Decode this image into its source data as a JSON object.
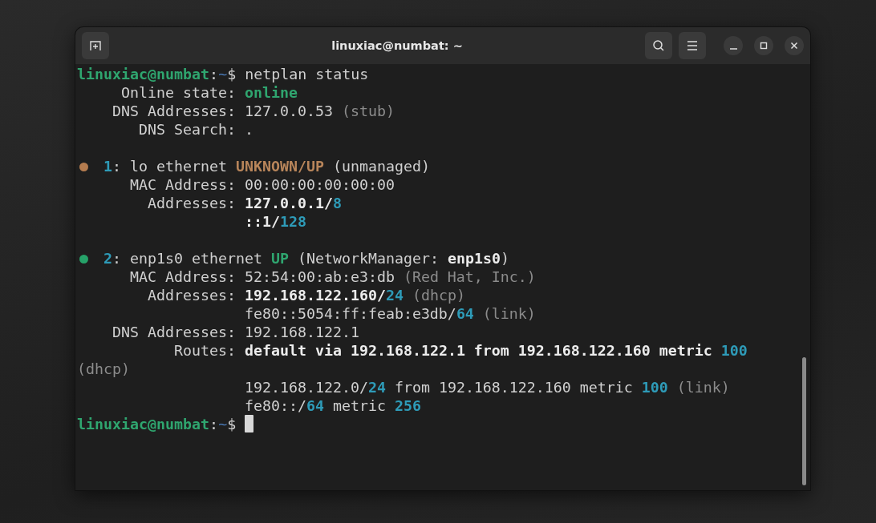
{
  "window": {
    "title": "linuxiac@numbat: ~"
  },
  "terminal": {
    "lines": [
      {
        "kind": "prompt",
        "segments": [
          {
            "kind": "user",
            "text": "linuxiac@numbat"
          },
          {
            "kind": "plain",
            "text": ":"
          },
          {
            "kind": "path",
            "text": "~"
          },
          {
            "kind": "plain",
            "text": "$ netplan status"
          }
        ]
      },
      {
        "kind": "text",
        "segments": [
          {
            "kind": "plain",
            "text": "     Online state: "
          },
          {
            "kind": "green",
            "text": "online"
          }
        ]
      },
      {
        "kind": "text",
        "segments": [
          {
            "kind": "plain",
            "text": "    DNS Addresses: 127.0.0.53"
          },
          {
            "kind": "dim",
            "text": " (stub)"
          }
        ]
      },
      {
        "kind": "text",
        "segments": [
          {
            "kind": "plain",
            "text": "       DNS Search: ."
          }
        ]
      },
      {
        "kind": "blank"
      },
      {
        "kind": "text",
        "dot": {
          "color": "#b57c4f"
        },
        "segments": [
          {
            "kind": "cyan",
            "text": "1"
          },
          {
            "kind": "plain",
            "text": ": lo ethernet "
          },
          {
            "kind": "amber",
            "text": "UNKNOWN/UP"
          },
          {
            "kind": "plain",
            "text": " (unmanaged)"
          }
        ]
      },
      {
        "kind": "text",
        "segments": [
          {
            "kind": "plain",
            "text": "      MAC Address: 00:00:00:00:00:00"
          }
        ]
      },
      {
        "kind": "text",
        "segments": [
          {
            "kind": "plain",
            "text": "        Addresses: "
          },
          {
            "kind": "bold",
            "text": "127.0.0.1/"
          },
          {
            "kind": "cyan",
            "text": "8"
          }
        ]
      },
      {
        "kind": "text",
        "segments": [
          {
            "kind": "bold",
            "text": "                   ::1/"
          },
          {
            "kind": "cyan",
            "text": "128"
          }
        ]
      },
      {
        "kind": "blank"
      },
      {
        "kind": "text",
        "dot": {
          "color": "#26a269"
        },
        "segments": [
          {
            "kind": "cyan",
            "text": "2"
          },
          {
            "kind": "plain",
            "text": ": enp1s0 ethernet "
          },
          {
            "kind": "green",
            "text": "UP"
          },
          {
            "kind": "plain",
            "text": " (NetworkManager: "
          },
          {
            "kind": "bold",
            "text": "enp1s0"
          },
          {
            "kind": "plain",
            "text": ")"
          }
        ]
      },
      {
        "kind": "text",
        "segments": [
          {
            "kind": "plain",
            "text": "      MAC Address: 52:54:00:ab:e3:db"
          },
          {
            "kind": "dim",
            "text": " (Red Hat, Inc.)"
          }
        ]
      },
      {
        "kind": "text",
        "segments": [
          {
            "kind": "plain",
            "text": "        Addresses: "
          },
          {
            "kind": "bold",
            "text": "192.168.122.160/"
          },
          {
            "kind": "cyan",
            "text": "24"
          },
          {
            "kind": "dim",
            "text": " (dhcp)"
          }
        ]
      },
      {
        "kind": "text",
        "segments": [
          {
            "kind": "plain",
            "text": "                   fe80::5054:ff:feab:e3db/"
          },
          {
            "kind": "cyan",
            "text": "64"
          },
          {
            "kind": "dim",
            "text": " (link)"
          }
        ]
      },
      {
        "kind": "text",
        "segments": [
          {
            "kind": "plain",
            "text": "    DNS Addresses: 192.168.122.1"
          }
        ]
      },
      {
        "kind": "text",
        "segments": [
          {
            "kind": "plain",
            "text": "           Routes: "
          },
          {
            "kind": "bold",
            "text": "default via 192.168.122.1 from 192.168.122.160 metric "
          },
          {
            "kind": "cyan",
            "text": "100"
          }
        ]
      },
      {
        "kind": "text",
        "segments": [
          {
            "kind": "dim",
            "text": "(dhcp)"
          }
        ]
      },
      {
        "kind": "text",
        "segments": [
          {
            "kind": "plain",
            "text": "                   192.168.122.0/"
          },
          {
            "kind": "cyan",
            "text": "24"
          },
          {
            "kind": "plain",
            "text": " from 192.168.122.160 metric "
          },
          {
            "kind": "cyan",
            "text": "100"
          },
          {
            "kind": "dim",
            "text": " (link)"
          }
        ]
      },
      {
        "kind": "text",
        "segments": [
          {
            "kind": "plain",
            "text": "                   fe80::/"
          },
          {
            "kind": "cyan",
            "text": "64"
          },
          {
            "kind": "plain",
            "text": " metric "
          },
          {
            "kind": "cyan",
            "text": "256"
          }
        ]
      },
      {
        "kind": "prompt",
        "cursor": true,
        "segments": [
          {
            "kind": "user",
            "text": "linuxiac@numbat"
          },
          {
            "kind": "plain",
            "text": ":"
          },
          {
            "kind": "path",
            "text": "~"
          },
          {
            "kind": "plain",
            "text": "$ "
          }
        ]
      }
    ]
  }
}
